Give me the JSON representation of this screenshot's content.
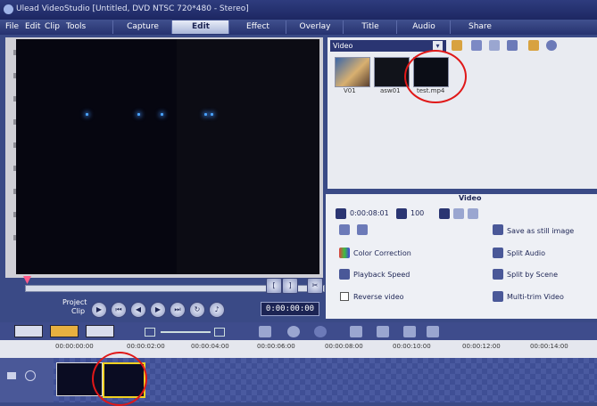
{
  "window": {
    "title": "Ulead VideoStudio [Untitled, DVD NTSC 720*480 - Stereo]"
  },
  "menu": {
    "file": "File",
    "edit": "Edit",
    "clip": "Clip",
    "tools": "Tools"
  },
  "tabs": [
    "Capture",
    "Edit",
    "Effect",
    "Overlay",
    "Title",
    "Audio",
    "Share"
  ],
  "library": {
    "category": "Video",
    "thumbs": [
      {
        "label": "V01",
        "color": "#c8a060"
      },
      {
        "label": "asw01",
        "color": "#11131a"
      },
      {
        "label": "test.mp4",
        "color": "#0b0d16"
      }
    ]
  },
  "player": {
    "project_label": "Project",
    "clip_label": "Clip",
    "timecode": "0:00:00:00"
  },
  "options": {
    "title": "Video",
    "duration": "0:00:08:01",
    "volume": "100",
    "reverse_video": "Reverse video",
    "save_still": "Save as still image",
    "color_correction": "Color Correction",
    "split_audio": "Split Audio",
    "playback_speed": "Playback Speed",
    "split_by_scene": "Split by Scene",
    "multi_trim": "Multi-trim Video"
  },
  "ruler": [
    "00:00:00:00",
    "00:00:02:00",
    "00:00:04:00",
    "00:00:06:00",
    "00:00:08:00",
    "00:00:10:00",
    "00:00:12:00",
    "00:00:14:00"
  ],
  "colors": {
    "accent": "#2a3572",
    "highlight": "#e01818"
  }
}
